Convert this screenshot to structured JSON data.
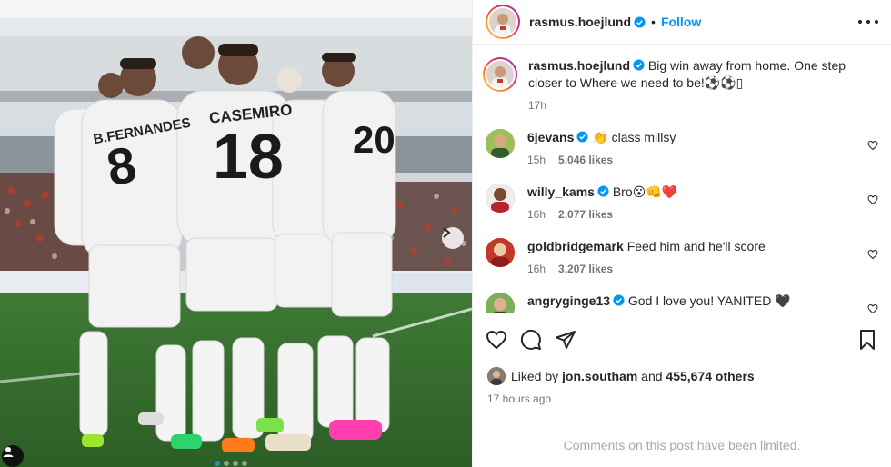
{
  "post": {
    "author": "rasmus.hoejlund",
    "follow_label": "Follow",
    "separator": "•",
    "caption": "Big win away from home. One step closer to Where we need to be!⚽⚽▯",
    "caption_time": "17h"
  },
  "media": {
    "players": [
      {
        "name": "B.FERNANDES",
        "number": "8"
      },
      {
        "name": "CASEMIRO",
        "number": "18"
      },
      {
        "name": "",
        "number": "20"
      }
    ],
    "carousel_count": 4,
    "carousel_active": 1
  },
  "comments": [
    {
      "user": "6jevans",
      "text": "👏 class millsy",
      "time": "15h",
      "likes": "5,046 likes",
      "avatar_color": "#4a7a3a"
    },
    {
      "user": "willy_kams",
      "text": "Bro😮👊❤️",
      "time": "16h",
      "likes": "2,077 likes",
      "avatar_color": "#b3262c"
    },
    {
      "user": "goldbridgemark",
      "text": "Feed him and he'll score",
      "time": "16h",
      "likes": "3,207 likes",
      "avatar_color": "#c0392b"
    },
    {
      "user": "angryginge13",
      "text": "God I love you! YANITED 🖤",
      "time": "",
      "likes": "",
      "avatar_color": "#6b8f4e"
    }
  ],
  "likes": {
    "prefix": "Liked by",
    "user": "jon.southam",
    "joiner": "and",
    "others": "455,674 others"
  },
  "timestamp": "17 hours ago",
  "limited_notice": "Comments on this post have been limited.",
  "colors": {
    "accent": "#0095f6",
    "verified": "#0095f6",
    "text": "#262626",
    "muted": "#737373",
    "heart_red": "#e0132c"
  }
}
